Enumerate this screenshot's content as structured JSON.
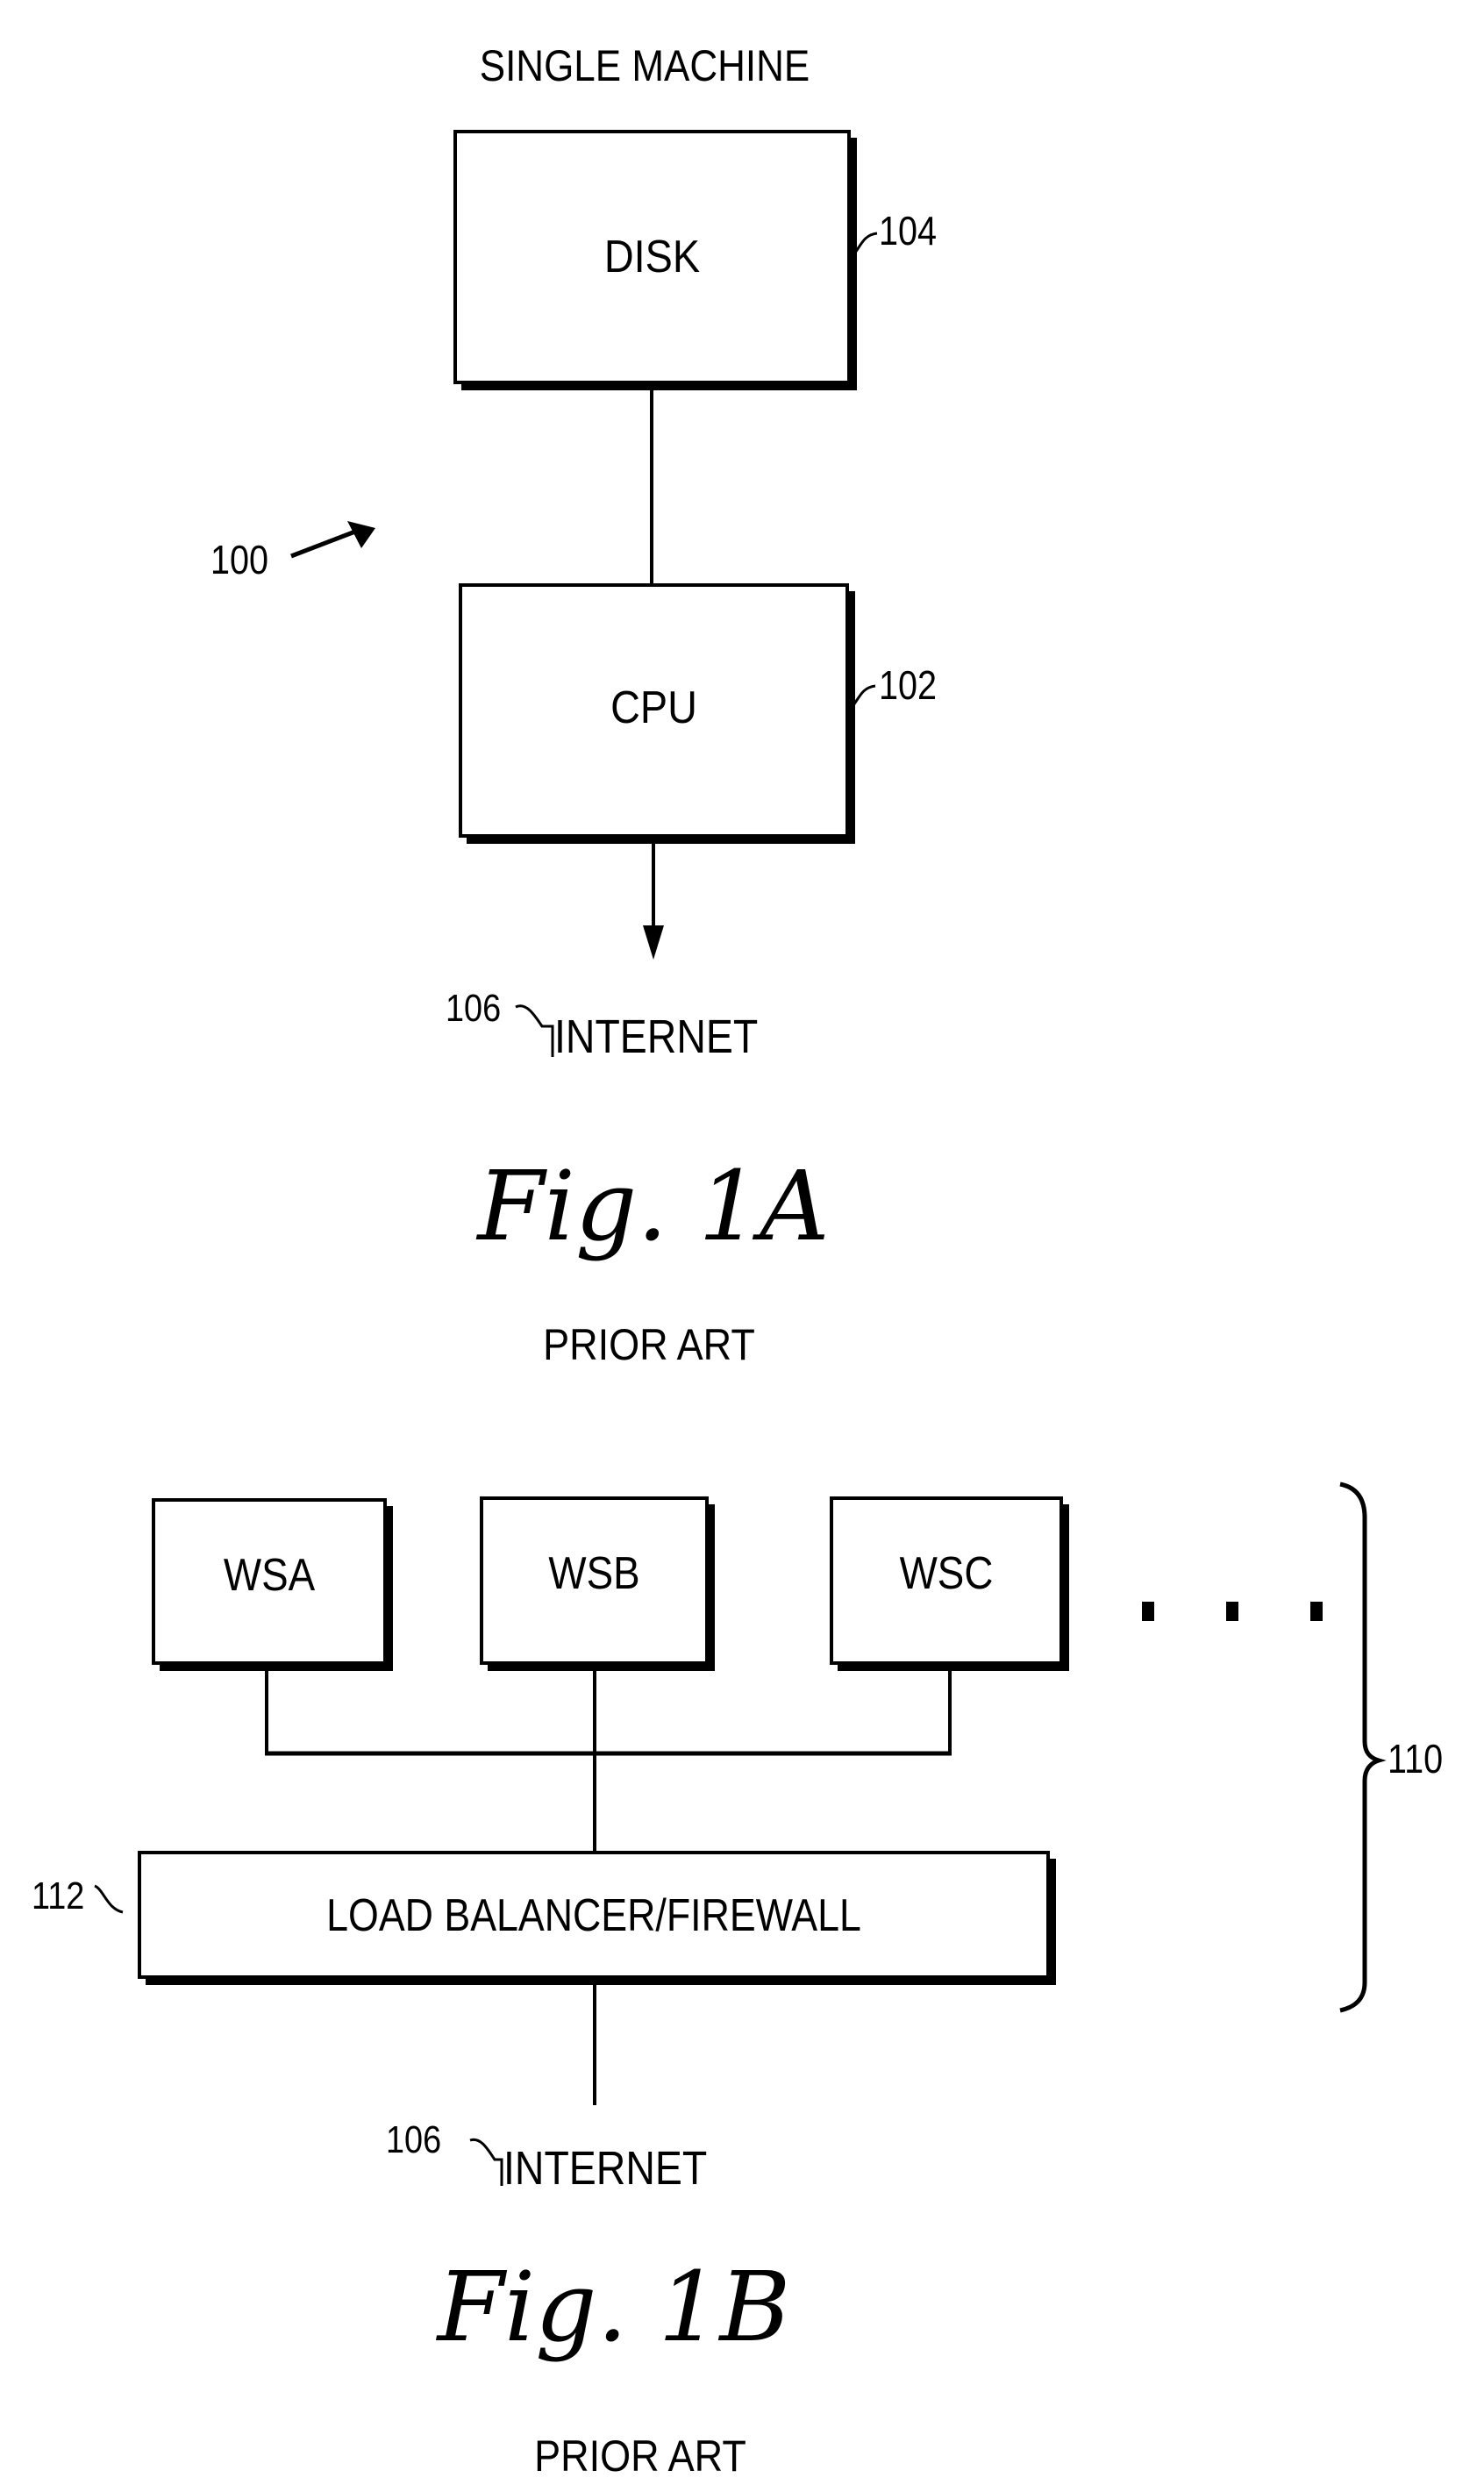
{
  "figure_1a": {
    "title": "SINGLE MACHINE",
    "system_ref": "100",
    "disk": {
      "label": "DISK",
      "ref": "104"
    },
    "cpu": {
      "label": "CPU",
      "ref": "102"
    },
    "internet": {
      "label": "INTERNET",
      "ref": "106"
    },
    "caption": "Fig. 1A",
    "subcaption": "PRIOR ART"
  },
  "figure_1b": {
    "servers": [
      {
        "label": "WSA"
      },
      {
        "label": "WSB"
      },
      {
        "label": "WSC"
      }
    ],
    "ellipsis": "...",
    "group_ref": "110",
    "load_balancer": {
      "label": "LOAD BALANCER/FIREWALL",
      "ref": "112"
    },
    "internet": {
      "label": "INTERNET",
      "ref": "106"
    },
    "caption": "Fig. 1B",
    "subcaption": "PRIOR ART"
  }
}
